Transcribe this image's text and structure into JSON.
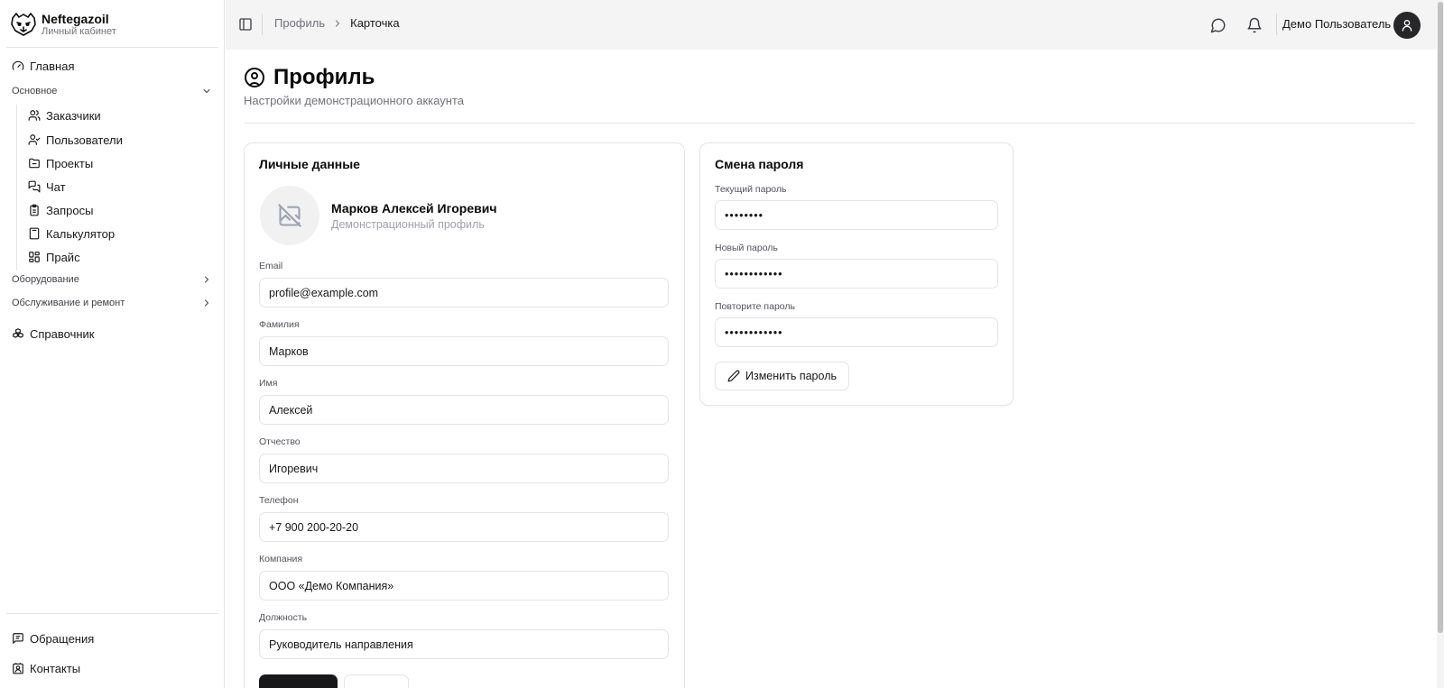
{
  "brand": {
    "name": "Neftegazoil",
    "subtitle": "Личный кабинет"
  },
  "sidebar": {
    "home": "Главная",
    "group_main": "Основное",
    "main_items": [
      {
        "label": "Заказчики",
        "icon": "users-icon"
      },
      {
        "label": "Пользователи",
        "icon": "user-check-icon"
      },
      {
        "label": "Проекты",
        "icon": "folder-icon"
      },
      {
        "label": "Чат",
        "icon": "messages-icon"
      },
      {
        "label": "Запросы",
        "icon": "clipboard-icon"
      },
      {
        "label": "Калькулятор",
        "icon": "calculator-icon"
      },
      {
        "label": "Прайс",
        "icon": "grid-icon"
      }
    ],
    "group_equipment": "Оборудование",
    "group_service": "Обслуживание и ремонт",
    "reference": "Справочник",
    "appeals": "Обращения",
    "contacts": "Контакты"
  },
  "header": {
    "breadcrumb_parent": "Профиль",
    "breadcrumb_current": "Карточка",
    "user_name": "Демо Пользователь"
  },
  "page": {
    "title": "Профиль",
    "subtitle": "Настройки демонстрационного аккаунта"
  },
  "personal": {
    "title": "Личные данные",
    "full_name": "Марков Алексей Игоревич",
    "role": "Демонстрационный профиль",
    "fields": [
      {
        "label": "Email",
        "value": "profile@example.com"
      },
      {
        "label": "Фамилия",
        "value": "Марков"
      },
      {
        "label": "Имя",
        "value": "Алексей"
      },
      {
        "label": "Отчество",
        "value": "Игоревич"
      },
      {
        "label": "Телефон",
        "value": "+7 900 200-20-20"
      },
      {
        "label": "Компания",
        "value": "ООО «Демо Компания»"
      },
      {
        "label": "Должность",
        "value": "Руководитель направления"
      }
    ]
  },
  "password": {
    "title": "Смена пароля",
    "fields": [
      {
        "label": "Текущий пароль",
        "value": "••••••••"
      },
      {
        "label": "Новый пароль",
        "value": "••••••••••••"
      },
      {
        "label": "Повторите пароль",
        "value": "••••••••••••"
      }
    ],
    "submit_label": "Изменить пароль"
  },
  "colors": {
    "primary": "#18181b",
    "muted": "#71717a",
    "border": "#e4e4e7",
    "header_bg": "#f4f4f5"
  }
}
